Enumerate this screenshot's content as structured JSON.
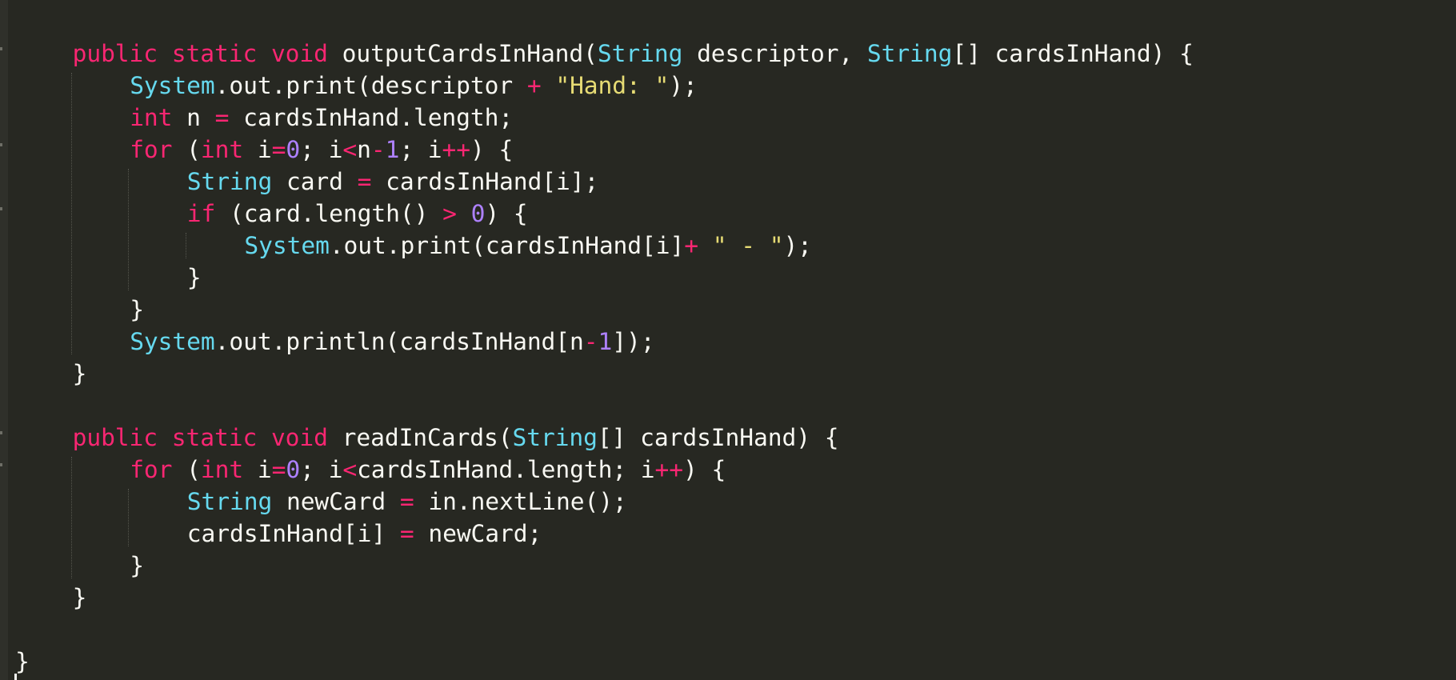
{
  "editor": {
    "theme_colors": {
      "background": "#272822",
      "gutter": "#2f302a",
      "text": "#F8F8F2",
      "keyword": "#F92672",
      "type": "#66D9EF",
      "number": "#AE81FF",
      "string": "#E6DB74"
    },
    "fold_marker_rows": [
      0,
      3,
      5,
      12,
      13
    ],
    "lines": [
      {
        "indent": 1,
        "tokens": [
          [
            "kw",
            "public"
          ],
          [
            "tx",
            " "
          ],
          [
            "kw",
            "static"
          ],
          [
            "tx",
            " "
          ],
          [
            "kw",
            "void"
          ],
          [
            "tx",
            " outputCardsInHand("
          ],
          [
            "ty",
            "String"
          ],
          [
            "tx",
            " descriptor, "
          ],
          [
            "ty",
            "String"
          ],
          [
            "tx",
            "[] cardsInHand) {"
          ]
        ]
      },
      {
        "indent": 2,
        "tokens": [
          [
            "ty",
            "System"
          ],
          [
            "tx",
            ".out.print(descriptor "
          ],
          [
            "op",
            "+"
          ],
          [
            "tx",
            " "
          ],
          [
            "st",
            "\"Hand: \""
          ],
          [
            "tx",
            ");"
          ]
        ]
      },
      {
        "indent": 2,
        "tokens": [
          [
            "kw",
            "int"
          ],
          [
            "tx",
            " n "
          ],
          [
            "op",
            "="
          ],
          [
            "tx",
            " cardsInHand.length;"
          ]
        ]
      },
      {
        "indent": 2,
        "tokens": [
          [
            "kw",
            "for"
          ],
          [
            "tx",
            " ("
          ],
          [
            "kw",
            "int"
          ],
          [
            "tx",
            " i"
          ],
          [
            "op",
            "="
          ],
          [
            "nu",
            "0"
          ],
          [
            "tx",
            "; i"
          ],
          [
            "op",
            "<"
          ],
          [
            "tx",
            "n"
          ],
          [
            "op",
            "-"
          ],
          [
            "nu",
            "1"
          ],
          [
            "tx",
            "; i"
          ],
          [
            "op",
            "++"
          ],
          [
            "tx",
            ") {"
          ]
        ]
      },
      {
        "indent": 3,
        "tokens": [
          [
            "ty",
            "String"
          ],
          [
            "tx",
            " card "
          ],
          [
            "op",
            "="
          ],
          [
            "tx",
            " cardsInHand[i];"
          ]
        ]
      },
      {
        "indent": 3,
        "tokens": [
          [
            "kw",
            "if"
          ],
          [
            "tx",
            " (card.length() "
          ],
          [
            "op",
            ">"
          ],
          [
            "tx",
            " "
          ],
          [
            "nu",
            "0"
          ],
          [
            "tx",
            ") {"
          ]
        ]
      },
      {
        "indent": 4,
        "tokens": [
          [
            "ty",
            "System"
          ],
          [
            "tx",
            ".out.print(cardsInHand[i]"
          ],
          [
            "op",
            "+"
          ],
          [
            "tx",
            " "
          ],
          [
            "st",
            "\" - \""
          ],
          [
            "tx",
            ");"
          ]
        ]
      },
      {
        "indent": 3,
        "tokens": [
          [
            "tx",
            "}"
          ]
        ]
      },
      {
        "indent": 2,
        "tokens": [
          [
            "tx",
            "}"
          ]
        ]
      },
      {
        "indent": 2,
        "tokens": [
          [
            "ty",
            "System"
          ],
          [
            "tx",
            ".out.println(cardsInHand[n"
          ],
          [
            "op",
            "-"
          ],
          [
            "nu",
            "1"
          ],
          [
            "tx",
            "]);"
          ]
        ]
      },
      {
        "indent": 1,
        "tokens": [
          [
            "tx",
            "}"
          ]
        ]
      },
      {
        "indent": 0,
        "tokens": []
      },
      {
        "indent": 1,
        "tokens": [
          [
            "kw",
            "public"
          ],
          [
            "tx",
            " "
          ],
          [
            "kw",
            "static"
          ],
          [
            "tx",
            " "
          ],
          [
            "kw",
            "void"
          ],
          [
            "tx",
            " readInCards("
          ],
          [
            "ty",
            "String"
          ],
          [
            "tx",
            "[] cardsInHand) {"
          ]
        ]
      },
      {
        "indent": 2,
        "tokens": [
          [
            "kw",
            "for"
          ],
          [
            "tx",
            " ("
          ],
          [
            "kw",
            "int"
          ],
          [
            "tx",
            " i"
          ],
          [
            "op",
            "="
          ],
          [
            "nu",
            "0"
          ],
          [
            "tx",
            "; i"
          ],
          [
            "op",
            "<"
          ],
          [
            "tx",
            "cardsInHand.length; i"
          ],
          [
            "op",
            "++"
          ],
          [
            "tx",
            ") {"
          ]
        ]
      },
      {
        "indent": 3,
        "tokens": [
          [
            "ty",
            "String"
          ],
          [
            "tx",
            " newCard "
          ],
          [
            "op",
            "="
          ],
          [
            "tx",
            " in.nextLine();"
          ]
        ]
      },
      {
        "indent": 3,
        "tokens": [
          [
            "tx",
            "cardsInHand[i] "
          ],
          [
            "op",
            "="
          ],
          [
            "tx",
            " newCard;"
          ]
        ]
      },
      {
        "indent": 2,
        "tokens": [
          [
            "tx",
            "}"
          ]
        ]
      },
      {
        "indent": 1,
        "tokens": [
          [
            "tx",
            "}"
          ]
        ]
      },
      {
        "indent": 0,
        "tokens": []
      },
      {
        "indent": 0,
        "tokens": [
          [
            "tx",
            "}"
          ]
        ]
      }
    ]
  }
}
